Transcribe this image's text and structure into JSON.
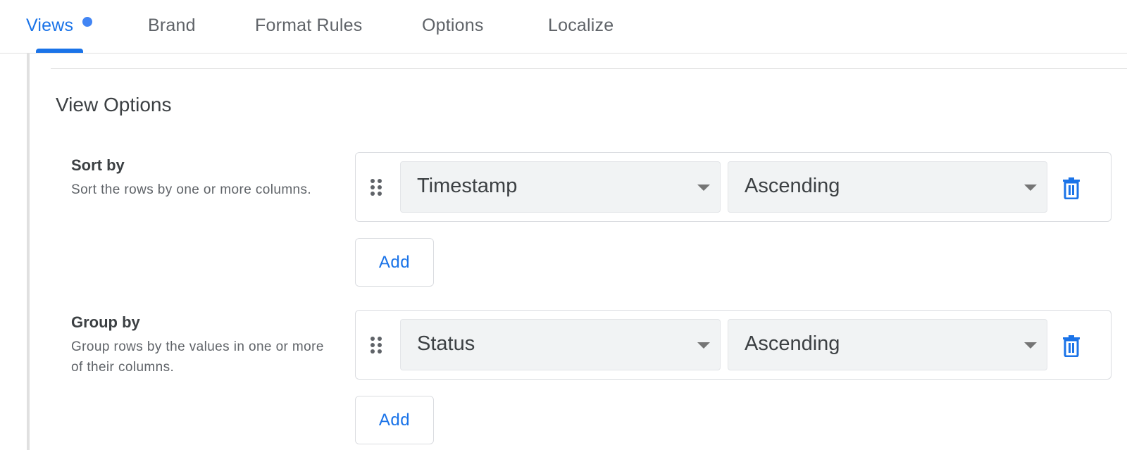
{
  "tabs": [
    {
      "label": "Views",
      "active": true,
      "has_indicator_dot": true
    },
    {
      "label": "Brand",
      "active": false
    },
    {
      "label": "Format Rules",
      "active": false
    },
    {
      "label": "Options",
      "active": false
    },
    {
      "label": "Localize",
      "active": false
    }
  ],
  "section": {
    "title": "View Options"
  },
  "sort_by": {
    "label": "Sort by",
    "description": "Sort the rows by one or more columns.",
    "rows": [
      {
        "column": "Timestamp",
        "order": "Ascending"
      }
    ],
    "add_label": "Add"
  },
  "group_by": {
    "label": "Group by",
    "description": "Group rows by the values in one or more of their columns.",
    "rows": [
      {
        "column": "Status",
        "order": "Ascending"
      }
    ],
    "add_label": "Add"
  },
  "colors": {
    "accent": "#1a73e8",
    "dot": "#4285f4",
    "dropdown_bg": "#f1f3f4",
    "muted_text": "#5f6368"
  },
  "icons": {
    "drag": "drag-indicator-icon",
    "delete": "trash-icon",
    "caret": "dropdown-caret-icon"
  }
}
